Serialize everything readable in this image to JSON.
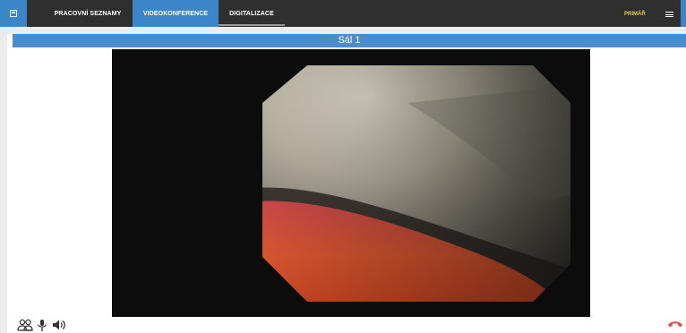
{
  "nav": {
    "tabs": [
      {
        "label": "PRACOVNÍ SEZNAMY",
        "active": false
      },
      {
        "label": "VIDEOKONFERENCE",
        "active": true
      },
      {
        "label": "DIGITALIZACE",
        "active": false
      }
    ],
    "user_label": "PRIMÁŘ"
  },
  "room": {
    "title": "Sál 1"
  },
  "controls": {
    "icons": [
      "participants-icon",
      "microphone-icon",
      "speaker-icon",
      "hangup-icon"
    ]
  },
  "colors": {
    "accent": "#3a86c8",
    "topbar": "#2f2f2f",
    "user_label": "#e6c84d",
    "hangup": "#d9534f"
  }
}
